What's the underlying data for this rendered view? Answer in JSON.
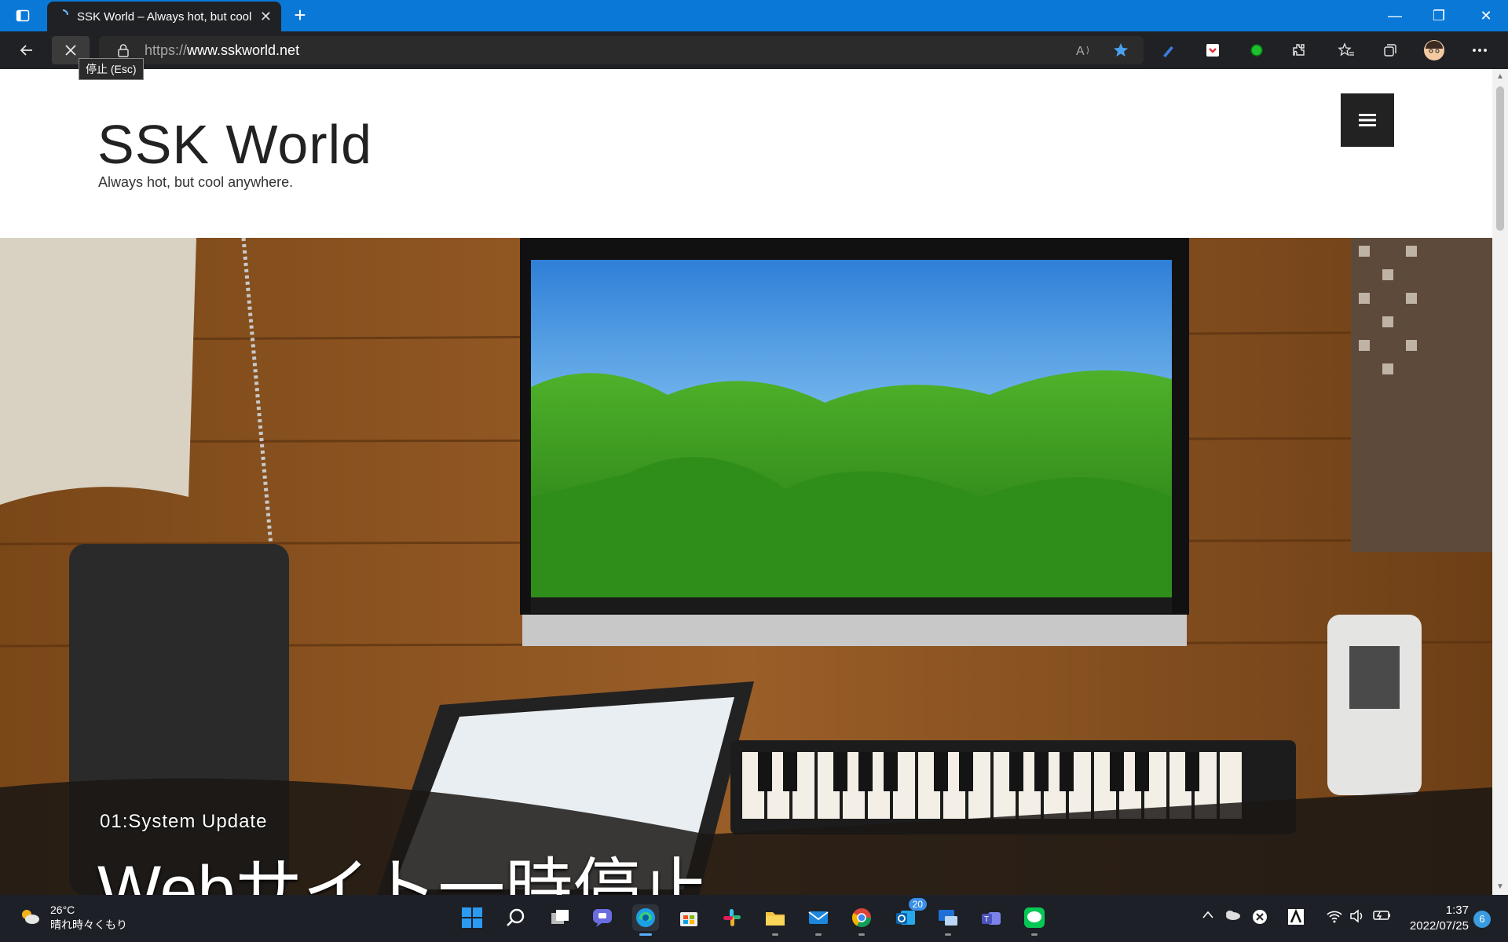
{
  "browser": {
    "tab": {
      "title": "SSK World – Always hot, but cool anywhere."
    },
    "address": {
      "scheme": "https://",
      "host": "www.sskworld.net"
    },
    "tooltip": "停止 (Esc)"
  },
  "site": {
    "title": "SSK World",
    "tagline": "Always hot, but cool anywhere."
  },
  "hero": {
    "kicker": "01:System Update",
    "title": "Webサイト一時停止"
  },
  "taskbar": {
    "weather": {
      "temp": "26°C",
      "condition": "晴れ時々くもり"
    },
    "mail_badge": "20",
    "clock": {
      "time": "1:37",
      "date": "2022/07/25"
    },
    "notifications": "6"
  },
  "colors": {
    "titlebar": "#0a78d7",
    "toolbar": "#202124",
    "taskbar": "#1d2026",
    "menu_button": "#222222"
  }
}
